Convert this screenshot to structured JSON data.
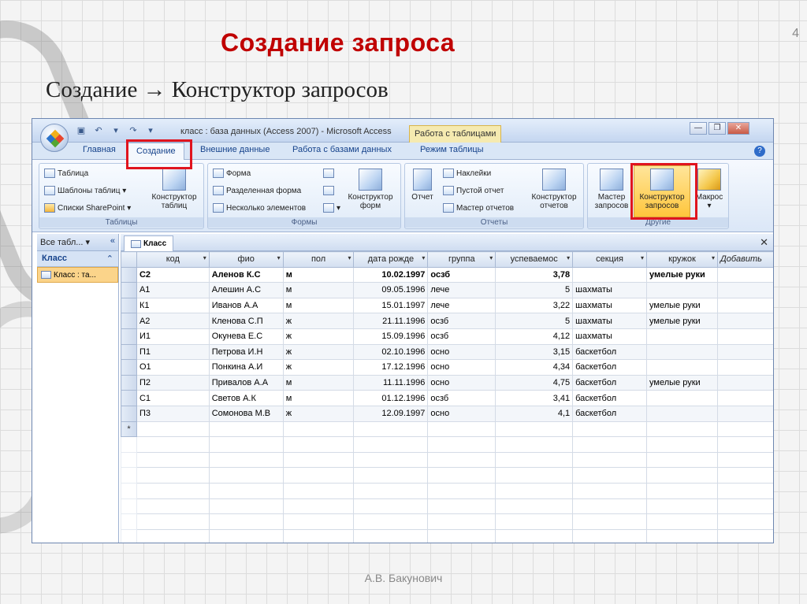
{
  "slide": {
    "title": "Создание запроса",
    "subtitle": "Создание → Конструктор запросов",
    "page_number": "4",
    "author": "А.В. Бакунович"
  },
  "window": {
    "title": "класс : база данных (Access 2007) - Microsoft Access",
    "contextual_tab": "Работа с таблицами"
  },
  "ribbon_tabs": [
    "Главная",
    "Создание",
    "Внешние данные",
    "Работа с базами данных",
    "Режим таблицы"
  ],
  "ribbon": {
    "tables": {
      "label": "Таблицы",
      "items": [
        "Таблица",
        "Шаблоны таблиц",
        "Списки SharePoint"
      ],
      "big": "Конструктор таблиц"
    },
    "forms": {
      "label": "Формы",
      "items": [
        "Форма",
        "Разделенная форма",
        "Несколько элементов"
      ],
      "big": "Конструктор форм"
    },
    "reports": {
      "label": "Отчеты",
      "report": "Отчет",
      "items": [
        "Наклейки",
        "Пустой отчет",
        "Мастер отчетов"
      ],
      "big": "Конструктор отчетов"
    },
    "other": {
      "label": "Другие",
      "wizard": "Мастер запросов",
      "designer": "Конструктор запросов",
      "macro": "Макрос"
    }
  },
  "nav": {
    "header": "Все табл...",
    "group": "Класс",
    "item": "Класс : та..."
  },
  "document_tab": "Класс",
  "table": {
    "columns": [
      "код",
      "фио",
      "пол",
      "дата рожде",
      "группа",
      "успеваемос",
      "секция",
      "кружок",
      "Добавить"
    ],
    "rows": [
      [
        "С2",
        "Аленов К.С",
        "м",
        "10.02.1997",
        "осзб",
        "3,78",
        "",
        "умелые руки"
      ],
      [
        "А1",
        "Алешин А.С",
        "м",
        "09.05.1996",
        "лече",
        "5",
        "шахматы",
        ""
      ],
      [
        "К1",
        "Иванов А.А",
        "м",
        "15.01.1997",
        "лече",
        "3,22",
        "шахматы",
        "умелые руки"
      ],
      [
        "А2",
        "Кленова С.П",
        "ж",
        "21.11.1996",
        "осзб",
        "5",
        "шахматы",
        "умелые руки"
      ],
      [
        "И1",
        "Окунева Е.С",
        "ж",
        "15.09.1996",
        "осзб",
        "4,12",
        "шахматы",
        ""
      ],
      [
        "П1",
        "Петрова И.Н",
        "ж",
        "02.10.1996",
        "осно",
        "3,15",
        "баскетбол",
        ""
      ],
      [
        "О1",
        "Понкина А.И",
        "ж",
        "17.12.1996",
        "осно",
        "4,34",
        "баскетбол",
        ""
      ],
      [
        "П2",
        "Привалов А.А",
        "м",
        "11.11.1996",
        "осно",
        "4,75",
        "баскетбол",
        "умелые руки"
      ],
      [
        "С1",
        "Светов А.К",
        "м",
        "01.12.1996",
        "осзб",
        "3,41",
        "баскетбол",
        ""
      ],
      [
        "П3",
        "Сомонова М.В",
        "ж",
        "12.09.1997",
        "осно",
        "4,1",
        "баскетбол",
        ""
      ]
    ],
    "new_row_marker": "*"
  }
}
